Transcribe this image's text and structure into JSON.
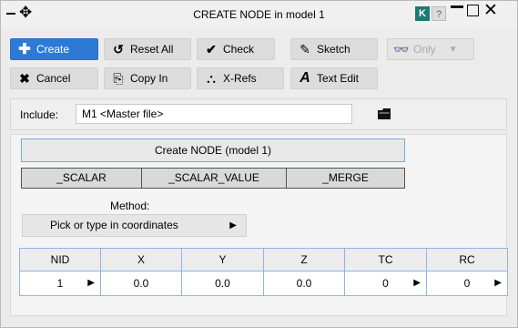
{
  "window": {
    "title": "CREATE NODE in model 1",
    "badge_k": "K",
    "badge_help": "?"
  },
  "toolbar": {
    "create": "Create",
    "reset_all": "Reset All",
    "check": "Check",
    "sketch": "Sketch",
    "only": "Only",
    "cancel": "Cancel",
    "copy_in": "Copy In",
    "x_refs": "X-Refs",
    "text_edit": "Text Edit"
  },
  "include": {
    "label": "Include:",
    "value": "M1  <Master file>"
  },
  "main": {
    "create_title": "Create NODE (model 1)",
    "segments": [
      "_SCALAR",
      "_SCALAR_VALUE",
      "_MERGE"
    ],
    "method_label": "Method:",
    "method_value": "Pick or type in coordinates"
  },
  "table": {
    "headers": [
      "NID",
      "X",
      "Y",
      "Z",
      "TC",
      "RC"
    ],
    "row": [
      "1",
      "0.0",
      "0.0",
      "0.0",
      "0",
      "0"
    ]
  },
  "colors": {
    "accent": "#2d7ad6",
    "badge_k": "#1d7a72",
    "table_border": "#8fb5e6"
  }
}
